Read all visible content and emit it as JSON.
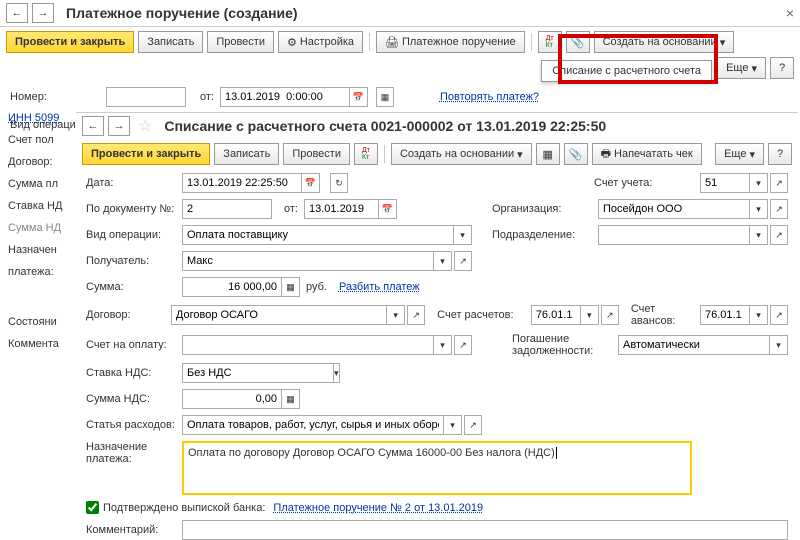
{
  "win1": {
    "title": "Платежное поручение (создание)",
    "toolbar": {
      "post_close": "Провести и закрыть",
      "save": "Записать",
      "post": "Провести",
      "settings": "Настройка",
      "payorder": "Платежное поручение",
      "create_based": "Создать на основании",
      "more": "Еще"
    },
    "dropdown_item": "Списание с расчетного счета",
    "num_lbl": "Номер:",
    "from_lbl": "от:",
    "date_val": "13.01.2019  0:00:00",
    "repeat_link": "Повторять платеж?",
    "op_lbl": "Вид операции:",
    "op_val": "Оплата поставщику",
    "org_lbl": "Организация:",
    "org_val": "Посейдон ООО",
    "recv_lbl": "Получатель"
  },
  "sidebar": {
    "inn": "ИНН 5099",
    "items": [
      "Счет пол",
      "Договор:",
      "Сумма пл",
      "Ставка НД",
      "Сумма НД",
      "Назначен",
      "платежа:",
      "",
      "Состояни",
      "Коммента"
    ]
  },
  "win2": {
    "title": "Списание с расчетного счета 0021-000002 от 13.01.2019 22:25:50",
    "toolbar": {
      "post_close": "Провести и закрыть",
      "save": "Записать",
      "post": "Провести",
      "create_based": "Создать на основании",
      "print_check": "Напечатать чек",
      "more": "Еще"
    },
    "rows": {
      "date_lbl": "Дата:",
      "date_val": "13.01.2019 22:25:50",
      "acct_lbl": "Счет учета:",
      "acct_val": "51",
      "docnum_lbl": "По документу №:",
      "docnum_val": "2",
      "from_lbl": "от:",
      "from_val": "13.01.2019",
      "org_lbl": "Организация:",
      "org_val": "Посейдон ООО",
      "op_lbl": "Вид операции:",
      "op_val": "Оплата поставщику",
      "div_lbl": "Подразделение:",
      "div_val": "",
      "recv_lbl": "Получатель:",
      "recv_val": "Макс",
      "sum_lbl": "Сумма:",
      "sum_val": "16 000,00",
      "rub": "руб.",
      "split": "Разбить платеж",
      "contract_lbl": "Договор:",
      "contract_val": "Договор ОСАГО",
      "racct_lbl": "Счет расчетов:",
      "racct_val": "76.01.1",
      "aacct_lbl": "Счет авансов:",
      "aacct_val": "76.01.1",
      "invoice_lbl": "Счет на оплату:",
      "invoice_val": "",
      "debt_lbl": "Погашение задолженности:",
      "debt_val": "Автоматически",
      "vat_lbl": "Ставка НДС:",
      "vat_val": "Без НДС",
      "vatsum_lbl": "Сумма НДС:",
      "vatsum_val": "0,00",
      "exp_lbl": "Статья расходов:",
      "exp_val": "Оплата товаров, работ, услуг, сырья и иных оборотных акти",
      "purp_lbl": "Назначение платежа:",
      "purp_val": "Оплата по договору Договор ОСАГО Сумма 16000-00 Без налога (НДС)",
      "confirm_lbl": "Подтверждено выпиской банка:",
      "confirm_link": "Платежное поручение № 2 от 13.01.2019",
      "comment_lbl": "Комментарий:"
    }
  }
}
